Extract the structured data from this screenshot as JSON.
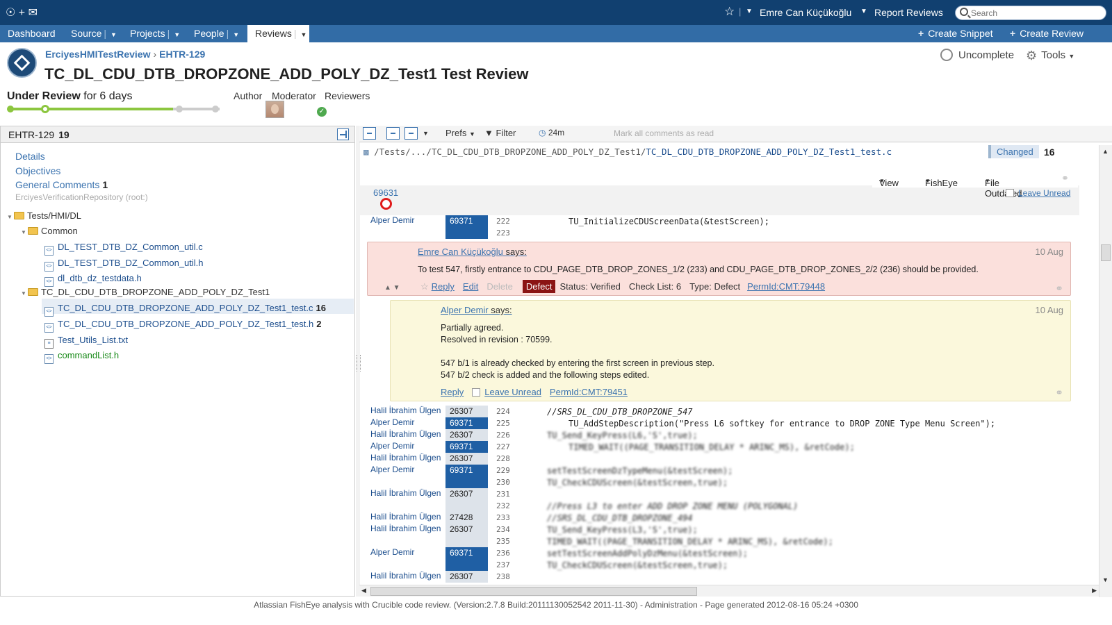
{
  "topbar": {
    "user": "Emre Can Küçükoğlu",
    "report_reviews": "Report Reviews",
    "search_placeholder": "Search"
  },
  "nav": {
    "items": [
      {
        "label": "Dashboard"
      },
      {
        "label": "Source"
      },
      {
        "label": "Projects"
      },
      {
        "label": "People"
      },
      {
        "label": "Reviews"
      }
    ],
    "create_snippet": "Create Snippet",
    "create_review": "Create Review"
  },
  "header": {
    "project": "ErciyesHMITestReview",
    "review_id": "EHTR-129",
    "title": "TC_DL_CDU_DTB_DROPZONE_ADD_POLY_DZ_Test1 Test Review",
    "state_label": "Under Review",
    "state_duration": "for 6 days",
    "roles": {
      "author": "Author",
      "moderator": "Moderator",
      "reviewers": "Reviewers"
    },
    "uncomplete": "Uncomplete",
    "tools": "Tools"
  },
  "left": {
    "review_id": "EHTR-129",
    "count": "19",
    "links": {
      "details": "Details",
      "objectives": "Objectives",
      "general_comments": "General Comments",
      "general_comments_count": "1"
    },
    "repo": "ErciyesVerificationRepository (root:)",
    "tree": {
      "root": "Tests/HMI/DL",
      "common": "Common",
      "common_files": [
        "DL_TEST_DTB_DZ_Common_util.c",
        "DL_TEST_DTB_DZ_Common_util.h",
        "dl_dtb_dz_testdata.h"
      ],
      "test_folder": "TC_DL_CDU_DTB_DROPZONE_ADD_POLY_DZ_Test1",
      "test_files": [
        {
          "name": "TC_DL_CDU_DTB_DROPZONE_ADD_POLY_DZ_Test1_test.c",
          "count": "16"
        },
        {
          "name": "TC_DL_CDU_DTB_DROPZONE_ADD_POLY_DZ_Test1_test.h",
          "count": "2"
        },
        {
          "name": "Test_Utils_List.txt",
          "count": ""
        },
        {
          "name": "commandList.h",
          "count": ""
        }
      ]
    }
  },
  "right": {
    "toolbar": {
      "prefs": "Prefs",
      "filter": "Filter",
      "time": "24m",
      "mark_read": "Mark all comments as read"
    },
    "path_prefix": "/Tests/.../TC_DL_CDU_DTB_DROPZONE_ADD_POLY_DZ_Test1/",
    "path_file": "TC_DL_CDU_DTB_DROPZONE_ADD_POLY_DZ_Test1_test.c",
    "changed": "Changed",
    "changed_count": "16",
    "file_options": {
      "view": "View",
      "fisheye": "FishEye",
      "outdated": "File Outdated"
    },
    "revision_header": "69631",
    "leave_unread": "Leave Unread",
    "lines_top": [
      {
        "author": "Alper Demir",
        "rev": "69371",
        "ln": "222",
        "text": "TU_InitializeCDUScreenData(&testScreen);"
      },
      {
        "author": "",
        "rev": "",
        "ln": "223",
        "text": ""
      }
    ],
    "comment1": {
      "author": "Emre Can Küçükoğlu",
      "says": "says:",
      "date": "10 Aug",
      "text": "To test 547, firstly entrance to CDU_PAGE_DTB_DROP_ZONES_1/2 (233) and CDU_PAGE_DTB_DROP_ZONES_2/2 (236) should be provided.",
      "reply": "Reply",
      "edit": "Edit",
      "delete": "Delete",
      "defect": "Defect",
      "status": "Status: Verified",
      "checklist": "Check List: 6",
      "type": "Type: Defect",
      "permid": "PermId:CMT:79448"
    },
    "comment2": {
      "author": "Alper Demir",
      "says": "says:",
      "date": "10 Aug",
      "line1": "Partially agreed.",
      "line2": "Resolved in revision : 70599.",
      "line3": "547 b/1 is already checked by entering the first screen in previous step.",
      "line4": "547 b/2 check is added and the following steps edited.",
      "reply": "Reply",
      "leave_unread": "Leave Unread",
      "permid": "PermId:CMT:79451"
    },
    "lines": [
      {
        "author": "Halil İbrahim Ülgen",
        "rev": "26307",
        "rtype": "b",
        "ln": "224",
        "text": "//SRS_DL_CDU_DTB_DROPZONE_547"
      },
      {
        "author": "Alper Demir",
        "rev": "69371",
        "rtype": "a",
        "ln": "225",
        "text": "TU_AddStepDescription(\"Press L6 softkey for entrance to DROP ZONE Type Menu Screen\");"
      },
      {
        "author": "Halil İbrahim Ülgen",
        "rev": "26307",
        "rtype": "b",
        "ln": "226",
        "text": "TU_Send_KeyPress(L6,'S',true);"
      },
      {
        "author": "Alper Demir",
        "rev": "69371",
        "rtype": "a",
        "ln": "227",
        "text": "TIMED_WAIT((PAGE_TRANSITION_DELAY * ARINC_MS), &retCode);"
      },
      {
        "author": "Halil İbrahim Ülgen",
        "rev": "26307",
        "rtype": "b",
        "ln": "228",
        "text": ""
      },
      {
        "author": "Alper Demir",
        "rev": "69371",
        "rtype": "a",
        "ln": "229",
        "text": "setTestScreenDzTypeMenu(&testScreen);"
      },
      {
        "author": "",
        "rev": "",
        "rtype": "a",
        "ln": "230",
        "text": "TU_CheckCDUScreen(&testScreen,true);"
      },
      {
        "author": "Halil İbrahim Ülgen",
        "rev": "26307",
        "rtype": "b",
        "ln": "231",
        "text": ""
      },
      {
        "author": "",
        "rev": "",
        "rtype": "b",
        "ln": "232",
        "text": "//Press L3 to enter ADD DROP ZONE MENU (POLYGONAL)"
      },
      {
        "author": "Halil İbrahim Ülgen",
        "rev": "27428",
        "rtype": "b",
        "ln": "233",
        "text": "//SRS_DL_CDU_DTB_DROPZONE_494"
      },
      {
        "author": "Halil İbrahim Ülgen",
        "rev": "26307",
        "rtype": "b",
        "ln": "234",
        "text": "TU_Send_KeyPress(L3,'S',true);"
      },
      {
        "author": "",
        "rev": "",
        "rtype": "b",
        "ln": "235",
        "text": "TIMED_WAIT((PAGE_TRANSITION_DELAY * ARINC_MS), &retCode);"
      },
      {
        "author": "Alper Demir",
        "rev": "69371",
        "rtype": "a",
        "ln": "236",
        "text": "setTestScreenAddPolyDzMenu(&testScreen);"
      },
      {
        "author": "",
        "rev": "",
        "rtype": "a",
        "ln": "237",
        "text": "TU_CheckCDUScreen(&testScreen,true);"
      },
      {
        "author": "Halil İbrahim Ülgen",
        "rev": "26307",
        "rtype": "b",
        "ln": "238",
        "text": ""
      }
    ]
  },
  "footer": "Atlassian FishEye analysis with Crucible code review. (Version:2.7.8 Build:20111130052542 2011-11-30) - Administration - Page generated 2012-08-16 05:24 +0300"
}
